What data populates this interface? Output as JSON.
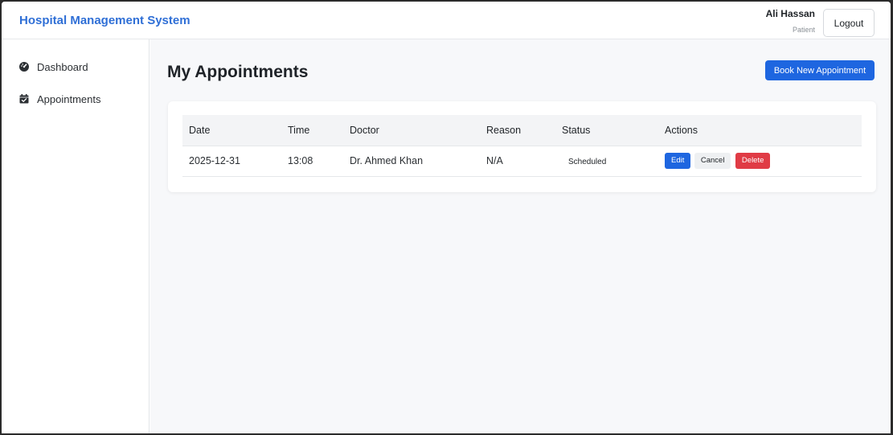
{
  "header": {
    "brand": "Hospital Management System",
    "user_name": "Ali Hassan",
    "user_role": "Patient",
    "logout_label": "Logout"
  },
  "sidebar": {
    "items": [
      {
        "label": "Dashboard",
        "icon": "gauge-icon"
      },
      {
        "label": "Appointments",
        "icon": "calendar-check-icon"
      }
    ]
  },
  "main": {
    "title": "My Appointments",
    "book_button_label": "Book New Appointment",
    "table": {
      "columns": [
        "Date",
        "Time",
        "Doctor",
        "Reason",
        "Status",
        "Actions"
      ],
      "rows": [
        {
          "date": "2025-12-31",
          "time": "13:08",
          "doctor": "Dr. Ahmed Khan",
          "reason": "N/A",
          "status": "Scheduled",
          "actions": {
            "edit": "Edit",
            "cancel": "Cancel",
            "delete": "Delete"
          }
        }
      ]
    }
  },
  "colors": {
    "brand": "#2f6fd6",
    "primary": "#1e66e0",
    "danger": "#e03b45"
  }
}
